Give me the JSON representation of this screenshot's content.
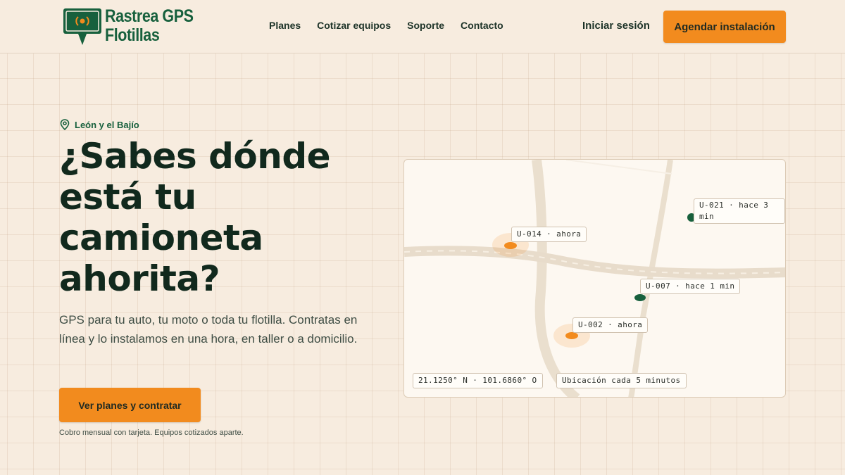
{
  "brand": {
    "line1": "Rastrea GPS",
    "line2": "Flotillas",
    "colors": {
      "primary": "#17603d",
      "accent": "#f28b1e",
      "background": "#f7ecdf"
    },
    "icon": "map-pin-signal-icon"
  },
  "nav": {
    "items": [
      {
        "label": "Planes"
      },
      {
        "label": "Cotizar equipos"
      },
      {
        "label": "Soporte"
      },
      {
        "label": "Contacto"
      }
    ],
    "login_label": "Iniciar sesión",
    "cta_label": "Agendar instalación"
  },
  "hero": {
    "location_icon": "location-pin-icon",
    "location": "León y el Bajío",
    "title": "¿Sabes dónde está tu camioneta ahorita?",
    "subtitle": "GPS para tu auto, tu moto o toda tu flotilla. Contratas en línea y lo instalamos en una hora, en taller o a domicilio.",
    "cta_label": "Ver planes y contratar",
    "note": "Cobro mensual con tarjeta. Equipos cotizados aparte."
  },
  "map": {
    "vehicles": [
      {
        "id": "U-021",
        "label": "U-021 · hace 3 min",
        "status": "stale",
        "color": "#17603d"
      },
      {
        "id": "U-014",
        "label": "U-014 · ahora",
        "status": "live",
        "color": "#f28b1e"
      },
      {
        "id": "U-007",
        "label": "U-007 · hace 1 min",
        "status": "stale",
        "color": "#17603d"
      },
      {
        "id": "U-002",
        "label": "U-002 · ahora",
        "status": "live",
        "color": "#f28b1e"
      }
    ],
    "coordinates": "21.1250° N · 101.6860° O",
    "update_interval": "Ubicación cada 5 minutos"
  }
}
